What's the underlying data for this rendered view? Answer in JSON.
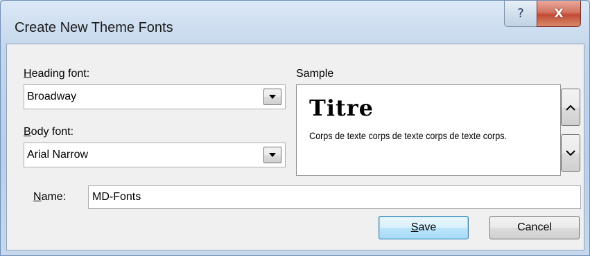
{
  "window": {
    "title": "Create New Theme Fonts",
    "help_glyph": "?",
    "close_glyph": "X"
  },
  "heading_font": {
    "label_accel": "H",
    "label_rest": "eading font:",
    "value": "Broadway"
  },
  "body_font": {
    "label_accel": "B",
    "label_rest": "ody font:",
    "value": "Arial Narrow"
  },
  "sample": {
    "label": "Sample",
    "heading_text": "Titre",
    "body_text": "Corps de texte corps de texte corps de texte corps."
  },
  "name": {
    "label_accel": "N",
    "label_rest": "ame:",
    "value": "MD-Fonts"
  },
  "buttons": {
    "save_accel": "S",
    "save_rest": "ave",
    "cancel": "Cancel"
  },
  "icons": {
    "help": "help-icon",
    "close": "close-icon",
    "dropdown": "chevron-down-icon",
    "scroll_up": "chevron-up-icon",
    "scroll_down": "chevron-down-icon"
  }
}
